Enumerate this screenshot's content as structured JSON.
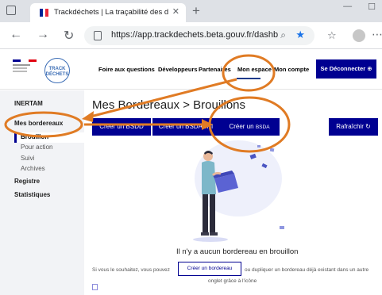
{
  "browser": {
    "tab_title": "Trackdéchets | La traçabilité des d",
    "url": "https://app.trackdechets.beta.gouv.fr/dashboa...",
    "new_tab": "+"
  },
  "logo": {
    "text": "TRACK DÉCHETS"
  },
  "nav": {
    "faq": "Foire aux questions",
    "dev": "Développeurs",
    "partners": "Partenaires",
    "space": "Mon espace",
    "account": "Mon compte",
    "logout": "Se Déconnecter"
  },
  "sidebar": {
    "company": "INERTAM",
    "section": "Mes bordereaux",
    "items": [
      "Brouillon",
      "Pour action",
      "Suivi",
      "Archives"
    ],
    "registre": "Registre",
    "stats": "Statistiques"
  },
  "main": {
    "title": "Mes Bordereaux > Brouillons",
    "btn_bsdd": "Créer un BSDD",
    "btn_bsdasri": "Créer un BSDASRI",
    "btn_bsda_prefix": "Créer un",
    "btn_bsda_type": "BSDA",
    "refresh": "Rafraîchir",
    "empty_message": "Il n'y a aucun bordereau en brouillon",
    "help_before": "Si vous le souhaitez, vous pouvez",
    "help_button": "Créer un bordereau",
    "help_after": "ou dupliquer un bordereau déjà existant dans un autre",
    "help_line2": "onglet grâce à l'icône"
  },
  "colors": {
    "primary": "#000091",
    "annotation": "#e07b24",
    "sidebar_bg": "#f2f3f6"
  }
}
